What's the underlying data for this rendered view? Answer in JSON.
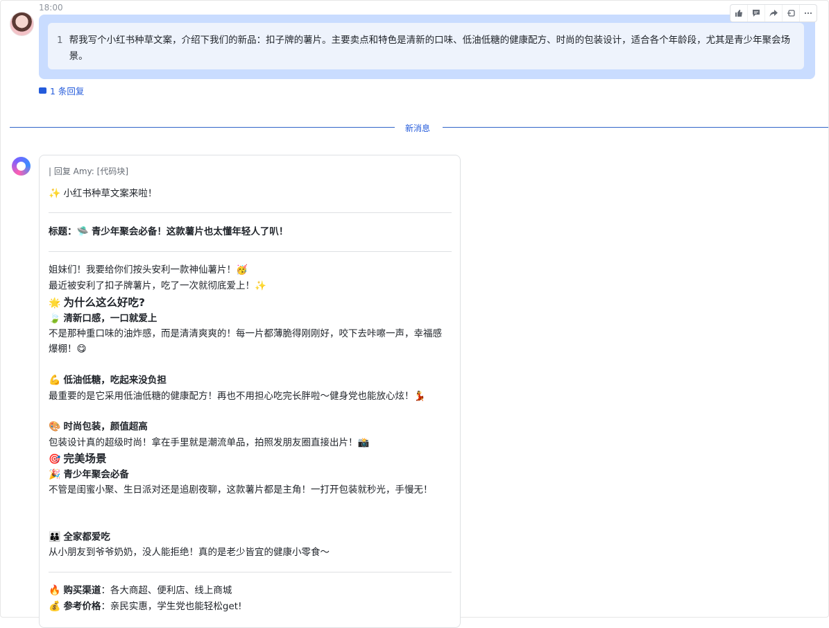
{
  "message1": {
    "time": "18:00",
    "code_line_number": "1",
    "code_text": "帮我写个小红书种草文案，介绍下我们的新品：扣子牌的薯片。主要卖点和特色是清新的口味、低油低糖的健康配方、时尚的包装设计，适合各个年龄段，尤其是青少年聚会场景。",
    "reply_count": "1 条回复",
    "actions": [
      "thumbs-up-icon",
      "comment-icon",
      "forward-icon",
      "pin-icon",
      "more-icon"
    ]
  },
  "divider": {
    "label": "新消息"
  },
  "bot": {
    "quote": "| 回复 Amy: [代码块]",
    "intro_emoji": "✨",
    "intro": "小红书种草文案来啦！",
    "title_label": "标题：",
    "title_emoji": "🛸",
    "title_text": "青少年聚会必备！这款薯片也太懂年轻人了叭！",
    "p1": "姐妹们！我要给你们按头安利一款神仙薯片！🥳",
    "p2": "最近被安利了扣子牌薯片，吃了一次就彻底爱上！✨",
    "why_emoji": "🌟",
    "why_heading": "为什么这么好吃?",
    "s1_emoji": "🍃",
    "s1_heading": "清新口感，一口就爱上",
    "s1_body": "不是那种重口味的油炸感，而是清清爽爽的！每一片都薄脆得刚刚好，咬下去咔嚓一声，幸福感爆棚！😋",
    "s2_emoji": "💪",
    "s2_heading": "低油低糖，吃起来没负担",
    "s2_body": "最重要的是它采用低油低糖的健康配方！再也不用担心吃完长胖啦～健身党也能放心炫！💃",
    "s3_emoji": "🎨",
    "s3_heading": "时尚包装，颜值超高",
    "s3_body": "包装设计真的超级时尚！拿在手里就是潮流单品，拍照发朋友圈直接出片！📸",
    "scene_emoji": "🎯",
    "scene_heading": "完美场景",
    "sc1_emoji": "🎉",
    "sc1_heading": "青少年聚会必备",
    "sc1_body": "不管是闺蜜小聚、生日派对还是追剧夜聊，这款薯片都是主角！一打开包装就秒光，手慢无！",
    "sc2_emoji": "👪",
    "sc2_heading": "全家都爱吃",
    "sc2_body": "从小朋友到爷爷奶奶，没人能拒绝！真的是老少皆宜的健康小零食～",
    "buy_emoji": "🔥",
    "buy_label": "购买渠道",
    "buy_text": "：各大商超、便利店、线上商城",
    "price_emoji": "💰",
    "price_label": "参考价格",
    "price_text": "：亲民实惠，学生党也能轻松get!"
  }
}
